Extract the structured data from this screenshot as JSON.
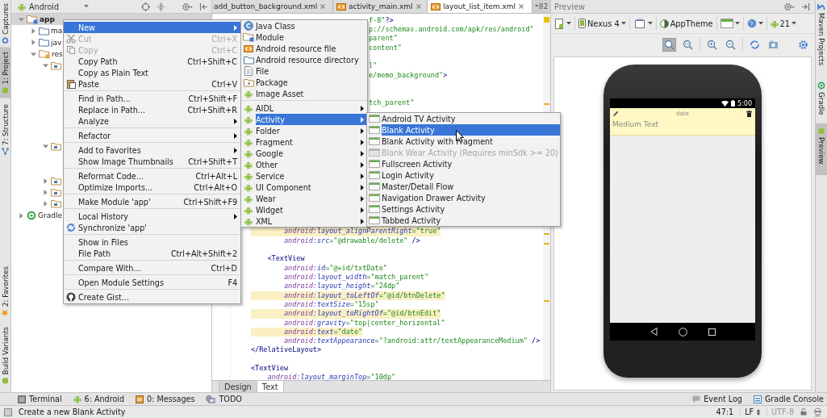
{
  "left_tool_strip": [
    {
      "label": "Captures",
      "selected": false
    },
    {
      "label": "1: Project",
      "selected": true
    },
    {
      "label": "7: Structure",
      "selected": false
    },
    {
      "label": "2: Favorites",
      "selected": false
    },
    {
      "label": "Build Variants",
      "selected": false
    }
  ],
  "project_panel": {
    "view_selector": "Android",
    "tree": [
      {
        "kind": "module",
        "label": "app",
        "expanded": true,
        "selected": true,
        "children": [
          {
            "kind": "folder",
            "label": "ma",
            "expanded": false,
            "selected": false
          },
          {
            "kind": "folder",
            "label": "jav",
            "expanded": false,
            "selected": false
          },
          {
            "kind": "res-folder",
            "label": "res",
            "expanded": true,
            "selected": false,
            "children": [
              {
                "kind": "source-folder",
                "expanded": true,
                "selected": false
              },
              {
                "kind": "source-folder",
                "expanded": true,
                "selected": false
              },
              {
                "kind": "source-folder",
                "expanded": false,
                "selected": false
              },
              {
                "kind": "source-folder",
                "expanded": false,
                "selected": false
              },
              {
                "kind": "source-folder",
                "expanded": false,
                "selected": false
              }
            ]
          }
        ]
      },
      {
        "kind": "gradle",
        "label": "Gradle",
        "expanded": false,
        "selected": false
      }
    ]
  },
  "editor": {
    "tabs": [
      {
        "kind": "cut",
        "label": "add_button_background.xml",
        "selected": false
      },
      {
        "kind": "xml",
        "label": "activity_main.xml",
        "selected": false
      },
      {
        "kind": "xml",
        "label": "layout_list_item.xml",
        "selected": true
      }
    ],
    "hidden_tabs_count": "2",
    "top_fragments": [
      {
        "segments": [
          {
            "kind": "value",
            "text": "f-8\""
          },
          {
            "kind": "tag",
            "text": "?>"
          }
        ]
      },
      {
        "segments": [
          {
            "kind": "value",
            "text": "p://schemas.android.com/apk/res/android\""
          }
        ]
      },
      {
        "segments": [
          {
            "kind": "value",
            "text": "parent\""
          }
        ]
      },
      {
        "segments": [
          {
            "kind": "value",
            "text": "content\""
          }
        ]
      },
      {
        "kind": "blank"
      },
      {
        "segments": [
          {
            "kind": "value",
            "text": "l\""
          }
        ]
      },
      {
        "segments": [
          {
            "kind": "value",
            "text": "e/memo_background\""
          },
          {
            "kind": "tag",
            "text": ">"
          }
        ]
      },
      {
        "kind": "blank"
      },
      {
        "kind": "blank"
      },
      {
        "segments": [
          {
            "kind": "value",
            "text": "tch_parent\""
          }
        ]
      }
    ],
    "lines": [
      {
        "highlighted": true,
        "segments": [
          {
            "kind": "ns",
            "text": "        android:"
          },
          {
            "kind": "attr",
            "text": "layout_alignParentRight"
          },
          {
            "kind": "value",
            "text": "=\"true\""
          }
        ]
      },
      {
        "highlighted": false,
        "segments": [
          {
            "kind": "ns",
            "text": "        android:"
          },
          {
            "kind": "attr",
            "text": "src"
          },
          {
            "kind": "value",
            "text": "=\"@drawable/delete\""
          },
          {
            "kind": "tag",
            "text": " />"
          }
        ]
      },
      {
        "kind": "blank"
      },
      {
        "highlighted": false,
        "segments": [
          {
            "kind": "tag",
            "text": "    <TextView"
          }
        ]
      },
      {
        "highlighted": false,
        "segments": [
          {
            "kind": "ns",
            "text": "        android:"
          },
          {
            "kind": "attr",
            "text": "id"
          },
          {
            "kind": "value",
            "text": "=\"@+id/txtDate\""
          }
        ]
      },
      {
        "highlighted": false,
        "segments": [
          {
            "kind": "ns",
            "text": "        android:"
          },
          {
            "kind": "attr",
            "text": "layout_width"
          },
          {
            "kind": "value",
            "text": "=\"match_parent\""
          }
        ]
      },
      {
        "highlighted": false,
        "segments": [
          {
            "kind": "ns",
            "text": "        android:"
          },
          {
            "kind": "attr",
            "text": "layout_height"
          },
          {
            "kind": "value",
            "text": "=\"24dp\""
          }
        ]
      },
      {
        "highlighted": true,
        "segments": [
          {
            "kind": "ns",
            "text": "        android:"
          },
          {
            "kind": "attr",
            "text": "layout_toLeftOf"
          },
          {
            "kind": "value",
            "text": "=\"@id/btnDelete\""
          }
        ]
      },
      {
        "highlighted": false,
        "segments": [
          {
            "kind": "ns",
            "text": "        android:"
          },
          {
            "kind": "attr",
            "text": "textSize"
          },
          {
            "kind": "value",
            "text": "=\"15sp\""
          }
        ]
      },
      {
        "highlighted": true,
        "segments": [
          {
            "kind": "ns",
            "text": "        android:"
          },
          {
            "kind": "attr",
            "text": "layout_toRightOf"
          },
          {
            "kind": "value",
            "text": "=\"@id/btnEdit\""
          }
        ]
      },
      {
        "highlighted": false,
        "segments": [
          {
            "kind": "ns",
            "text": "        android:"
          },
          {
            "kind": "attr",
            "text": "gravity"
          },
          {
            "kind": "value",
            "text": "=\"top|center_horizontal\""
          }
        ]
      },
      {
        "highlighted": true,
        "segments": [
          {
            "kind": "ns",
            "text": "        android:"
          },
          {
            "kind": "attr",
            "text": "text"
          },
          {
            "kind": "value",
            "text": "=\"date\""
          }
        ]
      },
      {
        "highlighted": false,
        "segments": [
          {
            "kind": "ns",
            "text": "        android:"
          },
          {
            "kind": "attr",
            "text": "textAppearance"
          },
          {
            "kind": "value",
            "text": "=\"?android:attr/textAppearanceMedium\""
          },
          {
            "kind": "tag",
            "text": " />"
          }
        ]
      },
      {
        "highlighted": false,
        "segments": [
          {
            "kind": "tag",
            "text": "</RelativeLayout>"
          }
        ]
      },
      {
        "kind": "blank"
      },
      {
        "highlighted": false,
        "segments": [
          {
            "kind": "tag",
            "text": "<TextView"
          }
        ]
      },
      {
        "highlighted": false,
        "segments": [
          {
            "kind": "ns",
            "text": "    android:"
          },
          {
            "kind": "attr",
            "text": "layout_marginTop"
          },
          {
            "kind": "value",
            "text": "=\"10dp\""
          }
        ]
      }
    ],
    "bottom_tabs": [
      {
        "label": "Design",
        "selected": false
      },
      {
        "label": "Text",
        "selected": true
      }
    ]
  },
  "preview": {
    "title": "Preview",
    "device": "Nexus 4",
    "theme": "AppTheme",
    "api_level": "21",
    "phone": {
      "time": "5:00",
      "item_title": "date",
      "item_text": "Medium Text"
    }
  },
  "right_tool_strip": [
    {
      "label": "Maven Projects",
      "selected": false
    },
    {
      "label": "Gradle",
      "selected": false
    },
    {
      "label": "Preview",
      "selected": true
    }
  ],
  "context_menu": {
    "items": [
      {
        "kind": "item",
        "label": "New",
        "submenu": true,
        "disabled": false,
        "selected": true
      },
      {
        "kind": "item",
        "label": "Cut",
        "shortcut": "Ctrl+X",
        "submenu": false,
        "disabled": true,
        "selected": false
      },
      {
        "kind": "item",
        "label": "Copy",
        "shortcut": "Ctrl+C",
        "submenu": false,
        "disabled": true,
        "selected": false
      },
      {
        "kind": "item",
        "label": "Copy Path",
        "shortcut": "Ctrl+Shift+C",
        "submenu": false,
        "disabled": false,
        "selected": false
      },
      {
        "kind": "item",
        "label": "Copy as Plain Text",
        "submenu": false,
        "disabled": false,
        "selected": false
      },
      {
        "kind": "item",
        "label": "Paste",
        "shortcut": "Ctrl+V",
        "submenu": false,
        "disabled": false,
        "selected": false
      },
      {
        "kind": "separator"
      },
      {
        "kind": "item",
        "label": "Find in Path...",
        "shortcut": "Ctrl+Shift+F",
        "submenu": false,
        "disabled": false,
        "selected": false
      },
      {
        "kind": "item",
        "label": "Replace in Path...",
        "shortcut": "Ctrl+Shift+R",
        "submenu": false,
        "disabled": false,
        "selected": false
      },
      {
        "kind": "item",
        "label": "Analyze",
        "submenu": true,
        "disabled": false,
        "selected": false
      },
      {
        "kind": "separator"
      },
      {
        "kind": "item",
        "label": "Refactor",
        "submenu": true,
        "disabled": false,
        "selected": false
      },
      {
        "kind": "separator"
      },
      {
        "kind": "item",
        "label": "Add to Favorites",
        "submenu": true,
        "disabled": false,
        "selected": false
      },
      {
        "kind": "item",
        "label": "Show Image Thumbnails",
        "shortcut": "Ctrl+Shift+T",
        "submenu": false,
        "disabled": false,
        "selected": false
      },
      {
        "kind": "separator"
      },
      {
        "kind": "item",
        "label": "Reformat Code...",
        "shortcut": "Ctrl+Alt+L",
        "submenu": false,
        "disabled": false,
        "selected": false
      },
      {
        "kind": "item",
        "label": "Optimize Imports...",
        "shortcut": "Ctrl+Alt+O",
        "submenu": false,
        "disabled": false,
        "selected": false
      },
      {
        "kind": "separator"
      },
      {
        "kind": "item",
        "label": "Make Module 'app'",
        "shortcut": "Ctrl+Shift+F9",
        "submenu": false,
        "disabled": false,
        "selected": false
      },
      {
        "kind": "separator"
      },
      {
        "kind": "item",
        "label": "Local History",
        "submenu": true,
        "disabled": false,
        "selected": false
      },
      {
        "kind": "item",
        "label": "Synchronize 'app'",
        "submenu": false,
        "disabled": false,
        "selected": false
      },
      {
        "kind": "separator"
      },
      {
        "kind": "item",
        "label": "Show in Files",
        "submenu": false,
        "disabled": false,
        "selected": false
      },
      {
        "kind": "item",
        "label": "File Path",
        "shortcut": "Ctrl+Alt+Shift+2",
        "submenu": false,
        "disabled": false,
        "selected": false
      },
      {
        "kind": "separator"
      },
      {
        "kind": "item",
        "label": "Compare With...",
        "shortcut": "Ctrl+D",
        "submenu": false,
        "disabled": false,
        "selected": false
      },
      {
        "kind": "separator"
      },
      {
        "kind": "item",
        "label": "Open Module Settings",
        "shortcut": "F4",
        "submenu": false,
        "disabled": false,
        "selected": false
      },
      {
        "kind": "separator"
      },
      {
        "kind": "item",
        "label": "Create Gist...",
        "submenu": false,
        "disabled": false,
        "selected": false
      }
    ]
  },
  "new_submenu": {
    "items": [
      {
        "kind": "item",
        "label": "Java Class",
        "submenu": false,
        "disabled": false,
        "selected": false
      },
      {
        "kind": "item",
        "label": "Module",
        "submenu": false,
        "disabled": false,
        "selected": false
      },
      {
        "kind": "item",
        "label": "Android resource file",
        "submenu": false,
        "disabled": false,
        "selected": false
      },
      {
        "kind": "item",
        "label": "Android resource directory",
        "submenu": false,
        "disabled": false,
        "selected": false
      },
      {
        "kind": "item",
        "label": "File",
        "submenu": false,
        "disabled": false,
        "selected": false
      },
      {
        "kind": "item",
        "label": "Package",
        "submenu": false,
        "disabled": false,
        "selected": false
      },
      {
        "kind": "item",
        "label": "Image Asset",
        "submenu": false,
        "disabled": false,
        "selected": false
      },
      {
        "kind": "separator"
      },
      {
        "kind": "item",
        "label": "AIDL",
        "submenu": true,
        "disabled": false,
        "selected": false
      },
      {
        "kind": "item",
        "label": "Activity",
        "submenu": true,
        "disabled": false,
        "selected": true
      },
      {
        "kind": "item",
        "label": "Folder",
        "submenu": true,
        "disabled": false,
        "selected": false
      },
      {
        "kind": "item",
        "label": "Fragment",
        "submenu": true,
        "disabled": false,
        "selected": false
      },
      {
        "kind": "item",
        "label": "Google",
        "submenu": true,
        "disabled": false,
        "selected": false
      },
      {
        "kind": "item",
        "label": "Other",
        "submenu": true,
        "disabled": false,
        "selected": false
      },
      {
        "kind": "item",
        "label": "Service",
        "submenu": true,
        "disabled": false,
        "selected": false
      },
      {
        "kind": "item",
        "label": "UI Component",
        "submenu": true,
        "disabled": false,
        "selected": false
      },
      {
        "kind": "item",
        "label": "Wear",
        "submenu": true,
        "disabled": false,
        "selected": false
      },
      {
        "kind": "item",
        "label": "Widget",
        "submenu": true,
        "disabled": false,
        "selected": false
      },
      {
        "kind": "item",
        "label": "XML",
        "submenu": true,
        "disabled": false,
        "selected": false
      }
    ]
  },
  "activity_submenu": {
    "items": [
      {
        "kind": "item",
        "label": "Android TV Activity",
        "submenu": false,
        "disabled": false,
        "selected": false
      },
      {
        "kind": "item",
        "label": "Blank Activity",
        "submenu": false,
        "disabled": false,
        "selected": true
      },
      {
        "kind": "item",
        "label": "Blank Activity with Fragment",
        "submenu": false,
        "disabled": false,
        "selected": false
      },
      {
        "kind": "item",
        "label": "Blank Wear Activity (Requires minSdk >= 20)",
        "submenu": false,
        "disabled": true,
        "selected": false
      },
      {
        "kind": "item",
        "label": "Fullscreen Activity",
        "submenu": false,
        "disabled": false,
        "selected": false
      },
      {
        "kind": "item",
        "label": "Login Activity",
        "submenu": false,
        "disabled": false,
        "selected": false
      },
      {
        "kind": "item",
        "label": "Master/Detail Flow",
        "submenu": false,
        "disabled": false,
        "selected": false
      },
      {
        "kind": "item",
        "label": "Navigation Drawer Activity",
        "submenu": false,
        "disabled": false,
        "selected": false
      },
      {
        "kind": "item",
        "label": "Settings Activity",
        "submenu": false,
        "disabled": false,
        "selected": false
      },
      {
        "kind": "item",
        "label": "Tabbed Activity",
        "submenu": false,
        "disabled": false,
        "selected": false
      }
    ]
  },
  "tool_window_bar": {
    "left": [
      {
        "label": "Terminal"
      },
      {
        "label": "6: Android"
      },
      {
        "label": "0: Messages"
      },
      {
        "label": "TODO"
      }
    ],
    "right": [
      {
        "label": "Event Log"
      },
      {
        "label": "Gradle Console"
      }
    ]
  },
  "status_bar": {
    "message": "Create a new Blank Activity",
    "position": "47:1",
    "line_separator": "LF",
    "encoding": "UTF-8"
  }
}
